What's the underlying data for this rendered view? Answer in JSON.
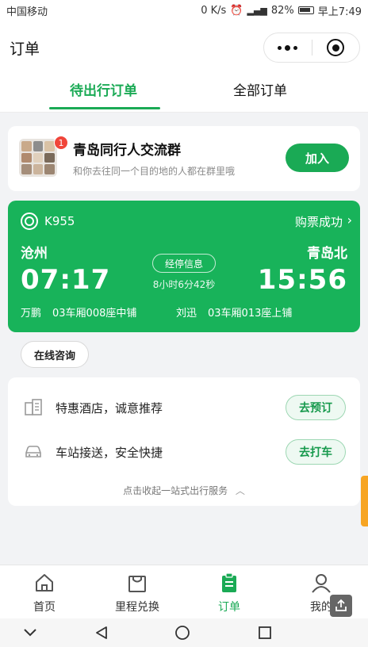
{
  "status_bar": {
    "carrier": "中国移动",
    "speed": "0 K/s",
    "battery": "82%",
    "time": "早上7:49"
  },
  "header": {
    "title": "订单"
  },
  "tabs": [
    {
      "label": "待出行订单",
      "active": true
    },
    {
      "label": "全部订单",
      "active": false
    }
  ],
  "group": {
    "badge": "1",
    "title": "青岛同行人交流群",
    "subtitle": "和你去往同一个目的地的人都在群里哦",
    "join_label": "加入"
  },
  "ticket": {
    "train_no": "K955",
    "status": "购票成功",
    "from_station": "沧州",
    "to_station": "青岛北",
    "depart_time": "07:17",
    "arrive_time": "15:56",
    "stop_info_label": "经停信息",
    "duration": "8小时6分42秒",
    "passengers": [
      {
        "name": "万鹏",
        "seat": "03车厢008座中铺"
      },
      {
        "name": "刘迅",
        "seat": "03车厢013座上铺"
      }
    ],
    "accent_color": "#18b35a"
  },
  "consult_label": "在线咨询",
  "services": [
    {
      "icon": "building-icon",
      "text": "特惠酒店，诚意推荐",
      "button": "去预订"
    },
    {
      "icon": "car-icon",
      "text": "车站接送，安全快捷",
      "button": "去打车"
    }
  ],
  "collapse_label": "点击收起一站式出行服务",
  "tabbar": [
    {
      "icon": "home-icon",
      "label": "首页",
      "active": false
    },
    {
      "icon": "shopping-bag-icon",
      "label": "里程兑换",
      "active": false
    },
    {
      "icon": "clipboard-icon",
      "label": "订单",
      "active": true
    },
    {
      "icon": "person-icon",
      "label": "我的",
      "active": false
    }
  ],
  "brand_color": "#1aaa55"
}
